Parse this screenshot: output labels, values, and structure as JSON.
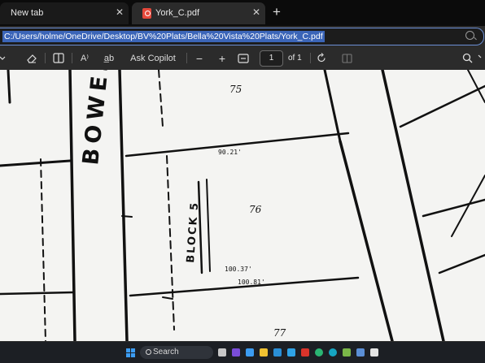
{
  "tabs": [
    {
      "title": "New tab",
      "close": "✕",
      "icon": "edge-newtab-icon"
    },
    {
      "title": "York_C.pdf",
      "close": "✕",
      "icon": "pdf-file-icon"
    }
  ],
  "new_tab_symbol": "+",
  "address_bar": {
    "url": "C:/Users/holme/OneDrive/Desktop/BV%20Plats/Bella%20Vista%20Plats/York_C.pdf"
  },
  "pdf_toolbar": {
    "ask_copilot": "Ask Copilot",
    "zoom_out": "−",
    "zoom_in": "+",
    "page_number": "1",
    "page_count": "of 1",
    "read_aloud": "A⁾",
    "translate": "a̲b"
  },
  "document": {
    "street_name": "BOWES",
    "block_label": "BLOCK 5",
    "lot_numbers": [
      "75",
      "76",
      "77"
    ],
    "dimension_labels": [
      "90.21'",
      "100.37'",
      "100.81'"
    ]
  },
  "taskbar": {
    "search_label": "Search",
    "accent_color": "#3c9cf1"
  }
}
